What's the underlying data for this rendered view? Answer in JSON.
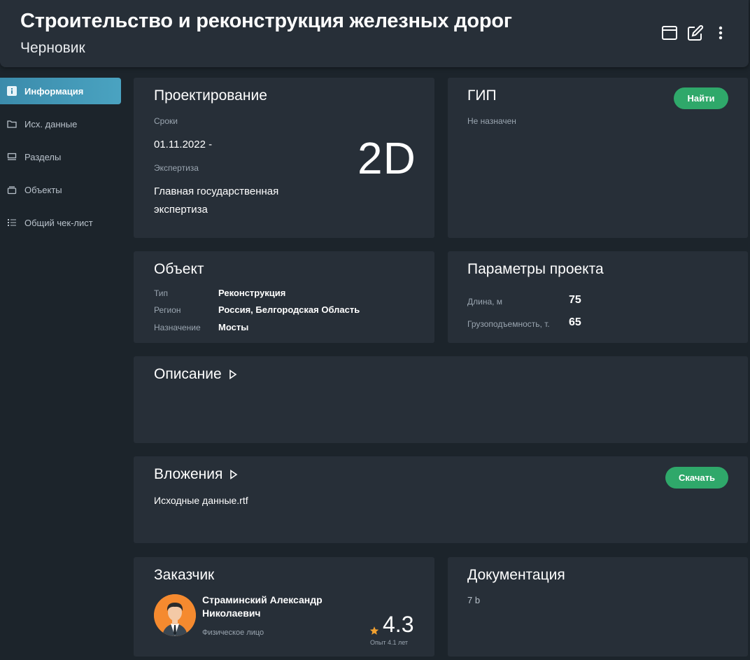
{
  "header": {
    "title": "Строительство и реконструкция железных дорог",
    "status": "Черновик",
    "icons": [
      "window-icon",
      "edit-icon",
      "more-vertical-icon"
    ]
  },
  "sidebar": {
    "items": [
      {
        "label": "Информация",
        "icon": "info-icon",
        "active": true
      },
      {
        "label": "Исх. данные",
        "icon": "folder-icon",
        "active": false
      },
      {
        "label": "Разделы",
        "icon": "sections-icon",
        "active": false
      },
      {
        "label": "Объекты",
        "icon": "objects-icon",
        "active": false
      },
      {
        "label": "Общий чек-лист",
        "icon": "checklist-icon",
        "active": false
      }
    ]
  },
  "design": {
    "title": "Проектирование",
    "terms_label": "Сроки",
    "terms_value": "01.11.2022 -",
    "expertise_label": "Экспертиза",
    "expertise_value_line1": "Главная государственная",
    "expertise_value_line2": "экспертиза",
    "mode": "2D"
  },
  "gip": {
    "title": "ГИП",
    "status": "Не назначен",
    "find_button": "Найти"
  },
  "object": {
    "title": "Объект",
    "rows": [
      {
        "label": "Тип",
        "value": "Реконструкция"
      },
      {
        "label": "Регион",
        "value": "Россия, Белгородская Область"
      },
      {
        "label": "Назначение",
        "value": "Мосты"
      }
    ]
  },
  "params": {
    "title": "Параметры проекта",
    "rows": [
      {
        "label": "Длина, м",
        "value": "75"
      },
      {
        "label": "Грузоподъемность, т.",
        "value": "65"
      }
    ]
  },
  "description": {
    "title": "Описание"
  },
  "attachments": {
    "title": "Вложения",
    "file": "Исходные данные.rtf",
    "download_button": "Скачать"
  },
  "customer": {
    "title": "Заказчик",
    "name_line1": "Страминский Александр",
    "name_line2": "Николаевич",
    "type": "Физическое лицо",
    "rating": "4.3",
    "experience": "Опыт 4.1 лет"
  },
  "docs": {
    "title": "Документация",
    "size": "7 b"
  },
  "colors": {
    "accent": "#3b8bab",
    "button": "#2fa86a",
    "card": "#272f38",
    "background": "#1c242b",
    "star": "#f0a030"
  }
}
